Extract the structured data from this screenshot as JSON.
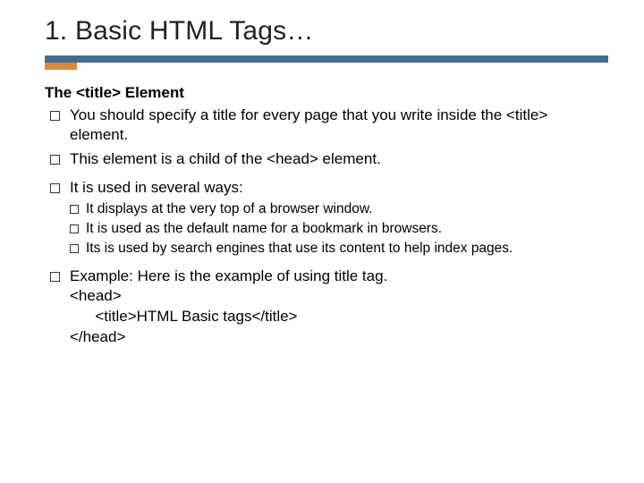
{
  "title": "1. Basic HTML Tags…",
  "subheading": "The <title> Element",
  "bullets": {
    "b0": "You should specify a title for every page that you write inside the <title> element.",
    "b1": "This element is a child of the <head> element.",
    "b2": "It is used in several ways:",
    "sub0": "It displays at the very top of a browser window.",
    "sub1": "It is used as the default name for a bookmark in browsers.",
    "sub2": "Its is used by search engines that use its content to help index pages.",
    "b3_intro": "Example: Here is the example of using title tag.",
    "code": "<head>\n      <title>HTML Basic tags</title>\n</head>"
  }
}
